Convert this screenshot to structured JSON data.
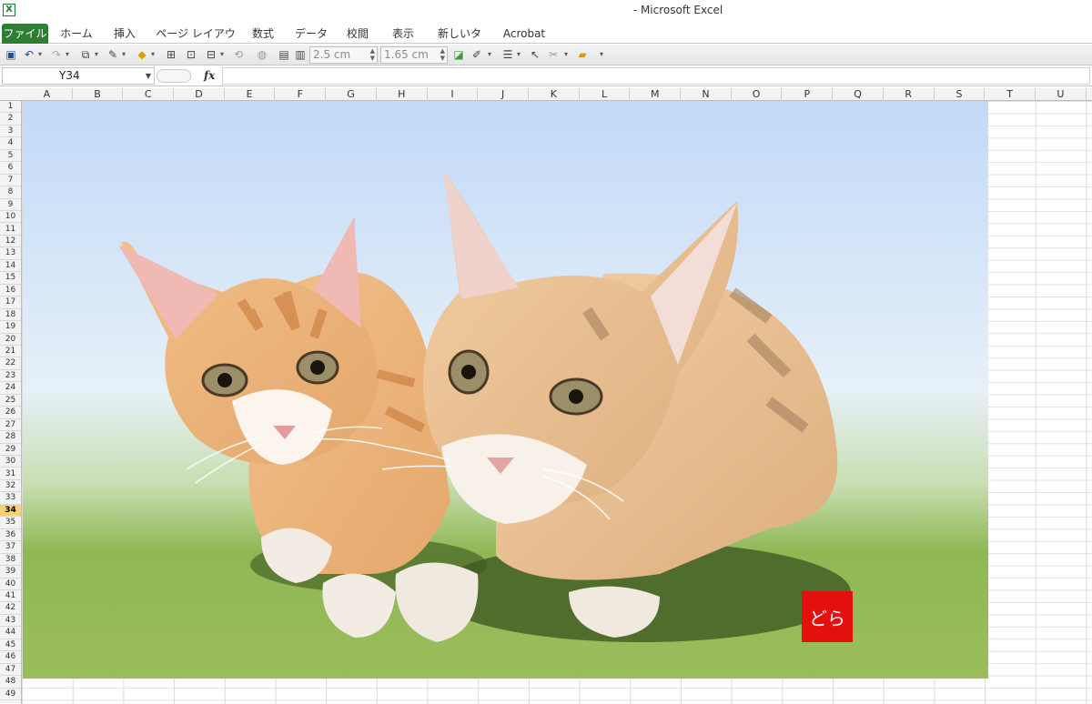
{
  "window": {
    "title": "- Microsoft Excel",
    "app_icon": "excel-icon"
  },
  "ribbon": {
    "tabs": [
      "ファイル",
      "ホーム",
      "挿入",
      "ページ レイアウト",
      "数式",
      "データ",
      "校閲",
      "表示",
      "新しいタブ",
      "Acrobat"
    ]
  },
  "toolbar": {
    "height_value": "2.5 cm",
    "width_value": "1.65 cm",
    "icons": [
      "save-icon",
      "undo-icon",
      "redo-icon",
      "shape-fill-icon",
      "shape-outline-icon",
      "fill-color-icon",
      "group-icon",
      "align-icon",
      "distribute-icon",
      "rotate-icon",
      "shadow-icon",
      "bring-forward-icon",
      "send-backward-icon",
      "apply-style-icon",
      "line-style-icon",
      "line-weight-icon",
      "select-icon",
      "format-painter-icon",
      "open-folder-icon",
      "customize-icon"
    ]
  },
  "formula_bar": {
    "name_box": "Y34",
    "fx_label": "fx",
    "content": ""
  },
  "grid": {
    "columns": [
      "A",
      "B",
      "C",
      "D",
      "E",
      "F",
      "G",
      "H",
      "I",
      "J",
      "K",
      "L",
      "M",
      "N",
      "O",
      "P",
      "Q",
      "R",
      "S",
      "T",
      "U"
    ],
    "rows": [
      "1",
      "2",
      "3",
      "4",
      "5",
      "6",
      "7",
      "8",
      "9",
      "10",
      "11",
      "12",
      "13",
      "14",
      "15",
      "16",
      "17",
      "18",
      "19",
      "20",
      "21",
      "22",
      "23",
      "24",
      "25",
      "26",
      "27",
      "28",
      "29",
      "30",
      "31",
      "32",
      "33",
      "34",
      "35",
      "36",
      "37",
      "38",
      "39",
      "40",
      "41",
      "42",
      "43",
      "44",
      "45",
      "46",
      "47",
      "48",
      "49"
    ],
    "active_row": "34"
  },
  "picture": {
    "subject": "two-orange-tabby-kittens",
    "seal_text": "どら",
    "colors": {
      "sky_top": "#c2d9f8",
      "sky_bottom": "#e6f0f8",
      "grass": "#8fb855",
      "seal": "#e3100e",
      "fur": "#e8b07a",
      "file_tab": "#2e7d32"
    }
  }
}
